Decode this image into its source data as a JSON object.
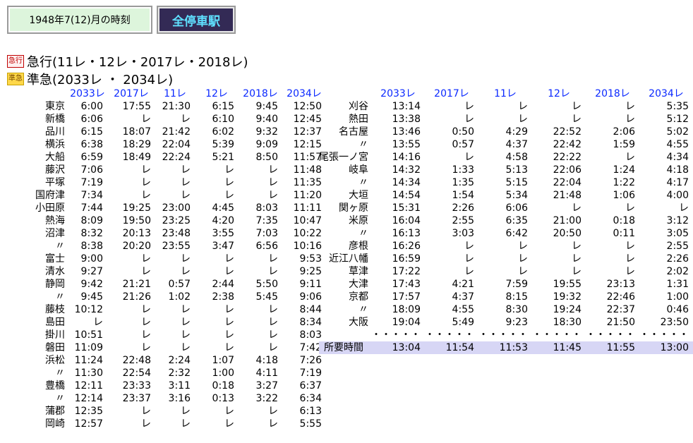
{
  "tabs": {
    "month_label": "1948年7(12)月の時刻",
    "station_label": "全停車駅"
  },
  "legend": {
    "express_badge": "急行",
    "express_text": "急行(11レ・12レ・2017レ・2018レ)",
    "semi_badge": "準急",
    "semi_text": "準急(2033レ ・ 2034レ)"
  },
  "columns": [
    "2033レ",
    "2017レ",
    "11レ",
    "12レ",
    "2018レ",
    "2034レ"
  ],
  "left_table": [
    {
      "station": "東京",
      "t": [
        "6:00",
        "17:55",
        "21:30",
        "6:15",
        "9:45",
        "12:50"
      ]
    },
    {
      "station": "新橋",
      "t": [
        "6:06",
        "レ",
        "レ",
        "6:10",
        "9:40",
        "12:45"
      ]
    },
    {
      "station": "品川",
      "t": [
        "6:15",
        "18:07",
        "21:42",
        "6:02",
        "9:32",
        "12:37"
      ]
    },
    {
      "station": "横浜",
      "t": [
        "6:38",
        "18:29",
        "22:04",
        "5:39",
        "9:09",
        "12:15"
      ]
    },
    {
      "station": "大船",
      "t": [
        "6:59",
        "18:49",
        "22:24",
        "5:21",
        "8:50",
        "11:57"
      ]
    },
    {
      "station": "藤沢",
      "t": [
        "7:06",
        "レ",
        "レ",
        "レ",
        "レ",
        "11:48"
      ]
    },
    {
      "station": "平塚",
      "t": [
        "7:19",
        "レ",
        "レ",
        "レ",
        "レ",
        "11:35"
      ]
    },
    {
      "station": "国府津",
      "t": [
        "7:34",
        "レ",
        "レ",
        "レ",
        "レ",
        "11:20"
      ]
    },
    {
      "station": "小田原",
      "t": [
        "7:44",
        "19:25",
        "23:00",
        "4:45",
        "8:03",
        "11:11"
      ]
    },
    {
      "station": "熱海",
      "t": [
        "8:09",
        "19:50",
        "23:25",
        "4:20",
        "7:35",
        "10:47"
      ]
    },
    {
      "station": "沼津",
      "t": [
        "8:32",
        "20:13",
        "23:48",
        "3:55",
        "7:03",
        "10:22"
      ]
    },
    {
      "station": "〃",
      "t": [
        "8:38",
        "20:20",
        "23:55",
        "3:47",
        "6:56",
        "10:16"
      ]
    },
    {
      "station": "富士",
      "t": [
        "9:00",
        "レ",
        "レ",
        "レ",
        "レ",
        "9:53"
      ]
    },
    {
      "station": "清水",
      "t": [
        "9:27",
        "レ",
        "レ",
        "レ",
        "レ",
        "9:25"
      ]
    },
    {
      "station": "静岡",
      "t": [
        "9:42",
        "21:21",
        "0:57",
        "2:44",
        "5:50",
        "9:11"
      ]
    },
    {
      "station": "〃",
      "t": [
        "9:45",
        "21:26",
        "1:02",
        "2:38",
        "5:45",
        "9:06"
      ]
    },
    {
      "station": "藤枝",
      "t": [
        "10:12",
        "レ",
        "レ",
        "レ",
        "レ",
        "8:44"
      ]
    },
    {
      "station": "島田",
      "t": [
        "レ",
        "レ",
        "レ",
        "レ",
        "レ",
        "8:34"
      ]
    },
    {
      "station": "掛川",
      "t": [
        "10:51",
        "レ",
        "レ",
        "レ",
        "レ",
        "8:03"
      ]
    },
    {
      "station": "磐田",
      "t": [
        "11:09",
        "レ",
        "レ",
        "レ",
        "レ",
        "7:42"
      ]
    },
    {
      "station": "浜松",
      "t": [
        "11:24",
        "22:48",
        "2:24",
        "1:07",
        "4:18",
        "7:26"
      ]
    },
    {
      "station": "〃",
      "t": [
        "11:30",
        "22:54",
        "2:32",
        "1:00",
        "4:11",
        "7:19"
      ]
    },
    {
      "station": "豊橋",
      "t": [
        "12:11",
        "23:33",
        "3:11",
        "0:18",
        "3:27",
        "6:37"
      ]
    },
    {
      "station": "〃",
      "t": [
        "12:14",
        "23:37",
        "3:16",
        "0:13",
        "3:22",
        "6:34"
      ]
    },
    {
      "station": "蒲郡",
      "t": [
        "12:35",
        "レ",
        "レ",
        "レ",
        "レ",
        "6:13"
      ]
    },
    {
      "station": "岡崎",
      "t": [
        "12:57",
        "レ",
        "レ",
        "レ",
        "レ",
        "5:55"
      ]
    }
  ],
  "right_table": [
    {
      "station": "刈谷",
      "t": [
        "13:14",
        "レ",
        "レ",
        "レ",
        "レ",
        "5:35"
      ]
    },
    {
      "station": "熱田",
      "t": [
        "13:38",
        "レ",
        "レ",
        "レ",
        "レ",
        "5:12"
      ]
    },
    {
      "station": "名古屋",
      "t": [
        "13:46",
        "0:50",
        "4:29",
        "22:52",
        "2:06",
        "5:02"
      ]
    },
    {
      "station": "〃",
      "t": [
        "13:55",
        "0:57",
        "4:37",
        "22:42",
        "1:59",
        "4:55"
      ]
    },
    {
      "station": "尾張一ノ宮",
      "t": [
        "14:16",
        "レ",
        "4:58",
        "22:22",
        "レ",
        "4:34"
      ]
    },
    {
      "station": "岐阜",
      "t": [
        "14:32",
        "1:33",
        "5:13",
        "22:06",
        "1:24",
        "4:18"
      ]
    },
    {
      "station": "〃",
      "t": [
        "14:34",
        "1:35",
        "5:15",
        "22:04",
        "1:22",
        "4:17"
      ]
    },
    {
      "station": "大垣",
      "t": [
        "14:54",
        "1:54",
        "5:34",
        "21:48",
        "1:06",
        "4:00"
      ]
    },
    {
      "station": "関ヶ原",
      "t": [
        "15:31",
        "2:26",
        "6:06",
        "レ",
        "レ",
        "レ"
      ]
    },
    {
      "station": "米原",
      "t": [
        "16:04",
        "2:55",
        "6:35",
        "21:00",
        "0:18",
        "3:12"
      ]
    },
    {
      "station": "〃",
      "t": [
        "16:13",
        "3:03",
        "6:42",
        "20:50",
        "0:11",
        "3:05"
      ]
    },
    {
      "station": "彦根",
      "t": [
        "16:26",
        "レ",
        "レ",
        "レ",
        "レ",
        "2:55"
      ]
    },
    {
      "station": "近江八幡",
      "t": [
        "16:59",
        "レ",
        "レ",
        "レ",
        "レ",
        "2:26"
      ]
    },
    {
      "station": "草津",
      "t": [
        "17:22",
        "レ",
        "レ",
        "レ",
        "レ",
        "2:02"
      ]
    },
    {
      "station": "大津",
      "t": [
        "17:43",
        "4:21",
        "7:59",
        "19:55",
        "23:13",
        "1:31"
      ]
    },
    {
      "station": "京都",
      "t": [
        "17:57",
        "4:37",
        "8:15",
        "19:32",
        "22:46",
        "1:00"
      ]
    },
    {
      "station": "〃",
      "t": [
        "18:09",
        "4:55",
        "8:30",
        "19:24",
        "22:37",
        "0:46"
      ]
    },
    {
      "station": "大阪",
      "t": [
        "19:04",
        "5:49",
        "9:23",
        "18:30",
        "21:50",
        "23:50"
      ]
    },
    {
      "station": "",
      "t": [
        "・・・・・",
        "・・・・・",
        "・・・・・",
        "・・・・・",
        "・・・・・",
        "・・・・・"
      ]
    }
  ],
  "total": {
    "label": "所要時間",
    "t": [
      "13:04",
      "11:54",
      "11:53",
      "11:45",
      "11:55",
      "13:00"
    ]
  }
}
